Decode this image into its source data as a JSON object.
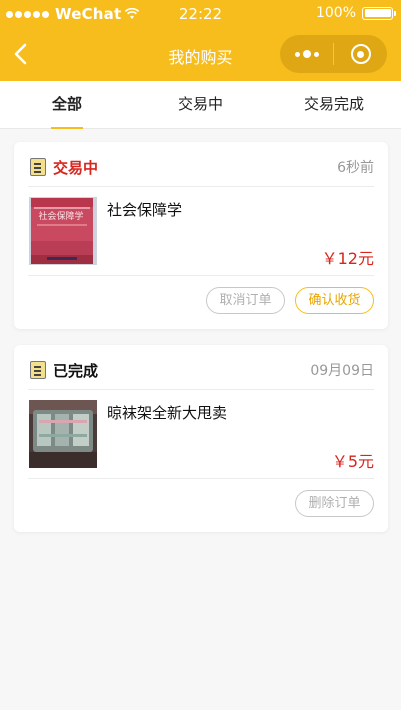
{
  "status_bar": {
    "carrier": "WeChat",
    "time": "22:22",
    "battery_percent": "100%",
    "battery_level": 1.0
  },
  "nav": {
    "title": "我的购买",
    "back_icon": "chevron-left-icon",
    "more_icon": "more-dots-icon",
    "close_icon": "target-circle-icon"
  },
  "tabs": [
    {
      "label": "全部",
      "active": true
    },
    {
      "label": "交易中",
      "active": false
    },
    {
      "label": "交易完成",
      "active": false
    }
  ],
  "orders": [
    {
      "status": "交易中",
      "time": "6秒前",
      "item_title": "社会保障学",
      "price": "￥12元",
      "cover_text": "社会保障学",
      "buttons": [
        "取消订单",
        "确认收货"
      ]
    },
    {
      "status": "已完成",
      "time": "09月09日",
      "item_title": "晾袜架全新大甩卖",
      "price": "￥5元",
      "buttons": [
        "删除订单"
      ]
    }
  ],
  "colors": {
    "brand": "#f7bd1d",
    "price": "#d8261e",
    "status_active": "#d8261e",
    "background": "#f7f7f7"
  }
}
